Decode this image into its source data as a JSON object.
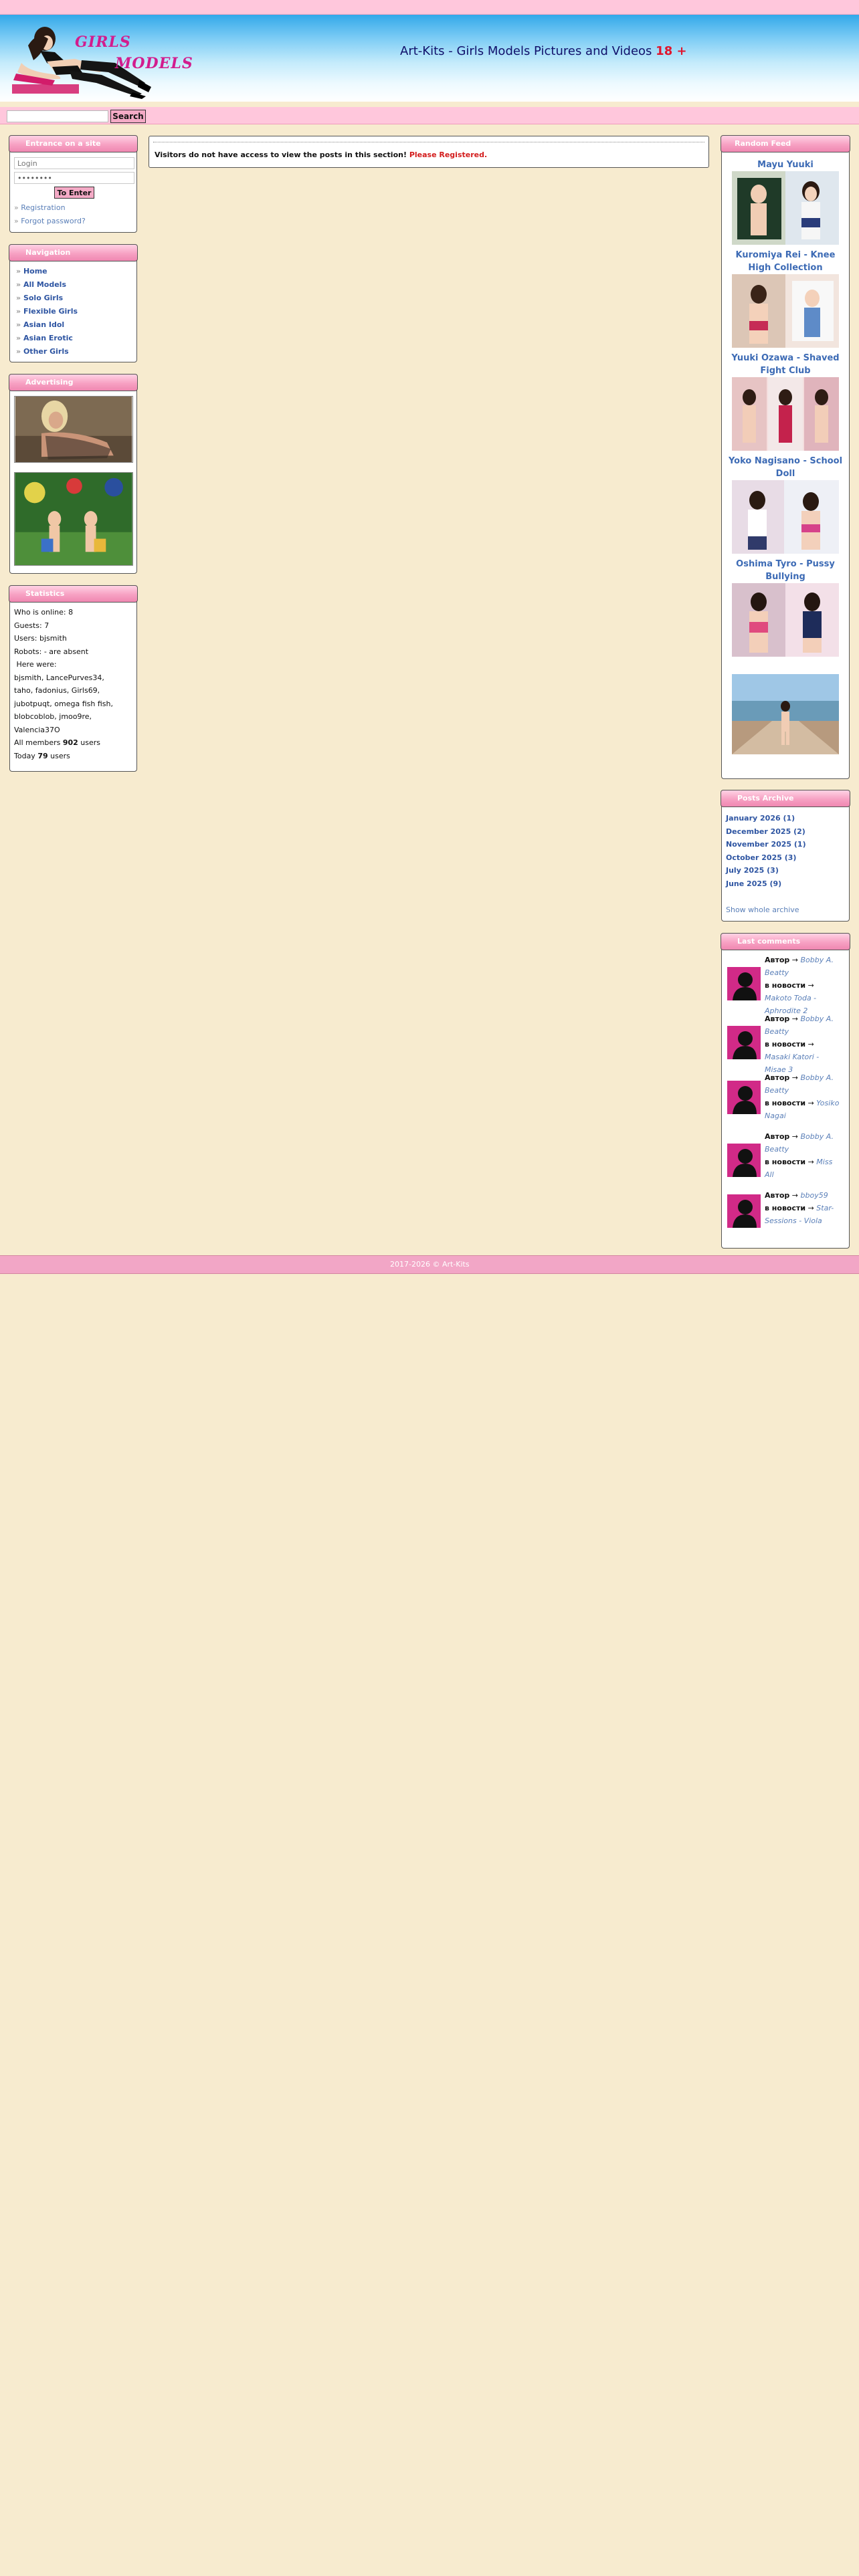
{
  "header": {
    "logo_text": "Girls Models",
    "site_title": "Art-Kits - Girls Models Pictures and Videos ",
    "age_badge": "18 +"
  },
  "search": {
    "value": "",
    "placeholder": "",
    "button": "Search"
  },
  "login": {
    "title": "Entrance on a site",
    "login_placeholder": "Login",
    "password_value": "••••••••",
    "submit": "To Enter",
    "registration": "Registration",
    "forgot": "Forgot password?",
    "bullet": "»"
  },
  "navigation": {
    "title": "Navigation",
    "items": [
      "Home",
      "All Models",
      "Solo Girls",
      "Flexible Girls",
      "Asian Idol",
      "Asian Erotic",
      "Other Girls"
    ]
  },
  "advertising": {
    "title": "Advertising"
  },
  "statistics": {
    "title": "Statistics",
    "lines": [
      "Who is online: 8",
      "Guests: 7",
      "Users:  bjsmith",
      "Robots:  - are absent",
      " Here were:",
      "bjsmith,  LancePurves34,",
      "taho,  fadonius,  Girls69,",
      "jubotpuqt,  omega fish fish,",
      "blobcoblob,  jmoo9re,",
      "Valencia37O"
    ],
    "members_prefix": "All members ",
    "members_count": "902",
    "members_suffix": " users",
    "today_prefix": "Today ",
    "today_count": "79",
    "today_suffix": " users"
  },
  "notice": {
    "text": "Visitors do not have access to view the posts in this section! ",
    "register": "Please Registered."
  },
  "random_feed": {
    "title": "Random Feed",
    "posts": [
      "Mayu Yuuki",
      "Kuromiya Rei - Knee High Collection",
      "Yuuki Ozawa - Shaved Fight Club",
      "Yoko Nagisano - School Doll",
      "Oshima Tyro - Pussy Bullying"
    ]
  },
  "posts_archive": {
    "title": "Posts Archive",
    "months": [
      "January 2026 (1)",
      "December 2025 (2)",
      "November 2025 (1)",
      "October 2025 (3)",
      "July 2025 (3)",
      "June 2025 (9)"
    ],
    "show_all": "Show whole archive"
  },
  "last_comments": {
    "title": "Last comments",
    "author_label": "Автор",
    "news_label": "в новости",
    "arrow": "→",
    "items": [
      {
        "author": "Bobby A. Beatty",
        "post": "Makoto Toda - Aphrodite 2"
      },
      {
        "author": "Bobby A. Beatty",
        "post": "Masaki Katori - Misae 3"
      },
      {
        "author": "Bobby A. Beatty",
        "post": "Yosiko Nagai"
      },
      {
        "author": "Bobby A. Beatty",
        "post": "Miss All"
      },
      {
        "author": "bboy59",
        "post": "Star-Sessions - Viola"
      }
    ]
  },
  "footer": {
    "copyright": "2017-2026 © Art-Kits"
  }
}
